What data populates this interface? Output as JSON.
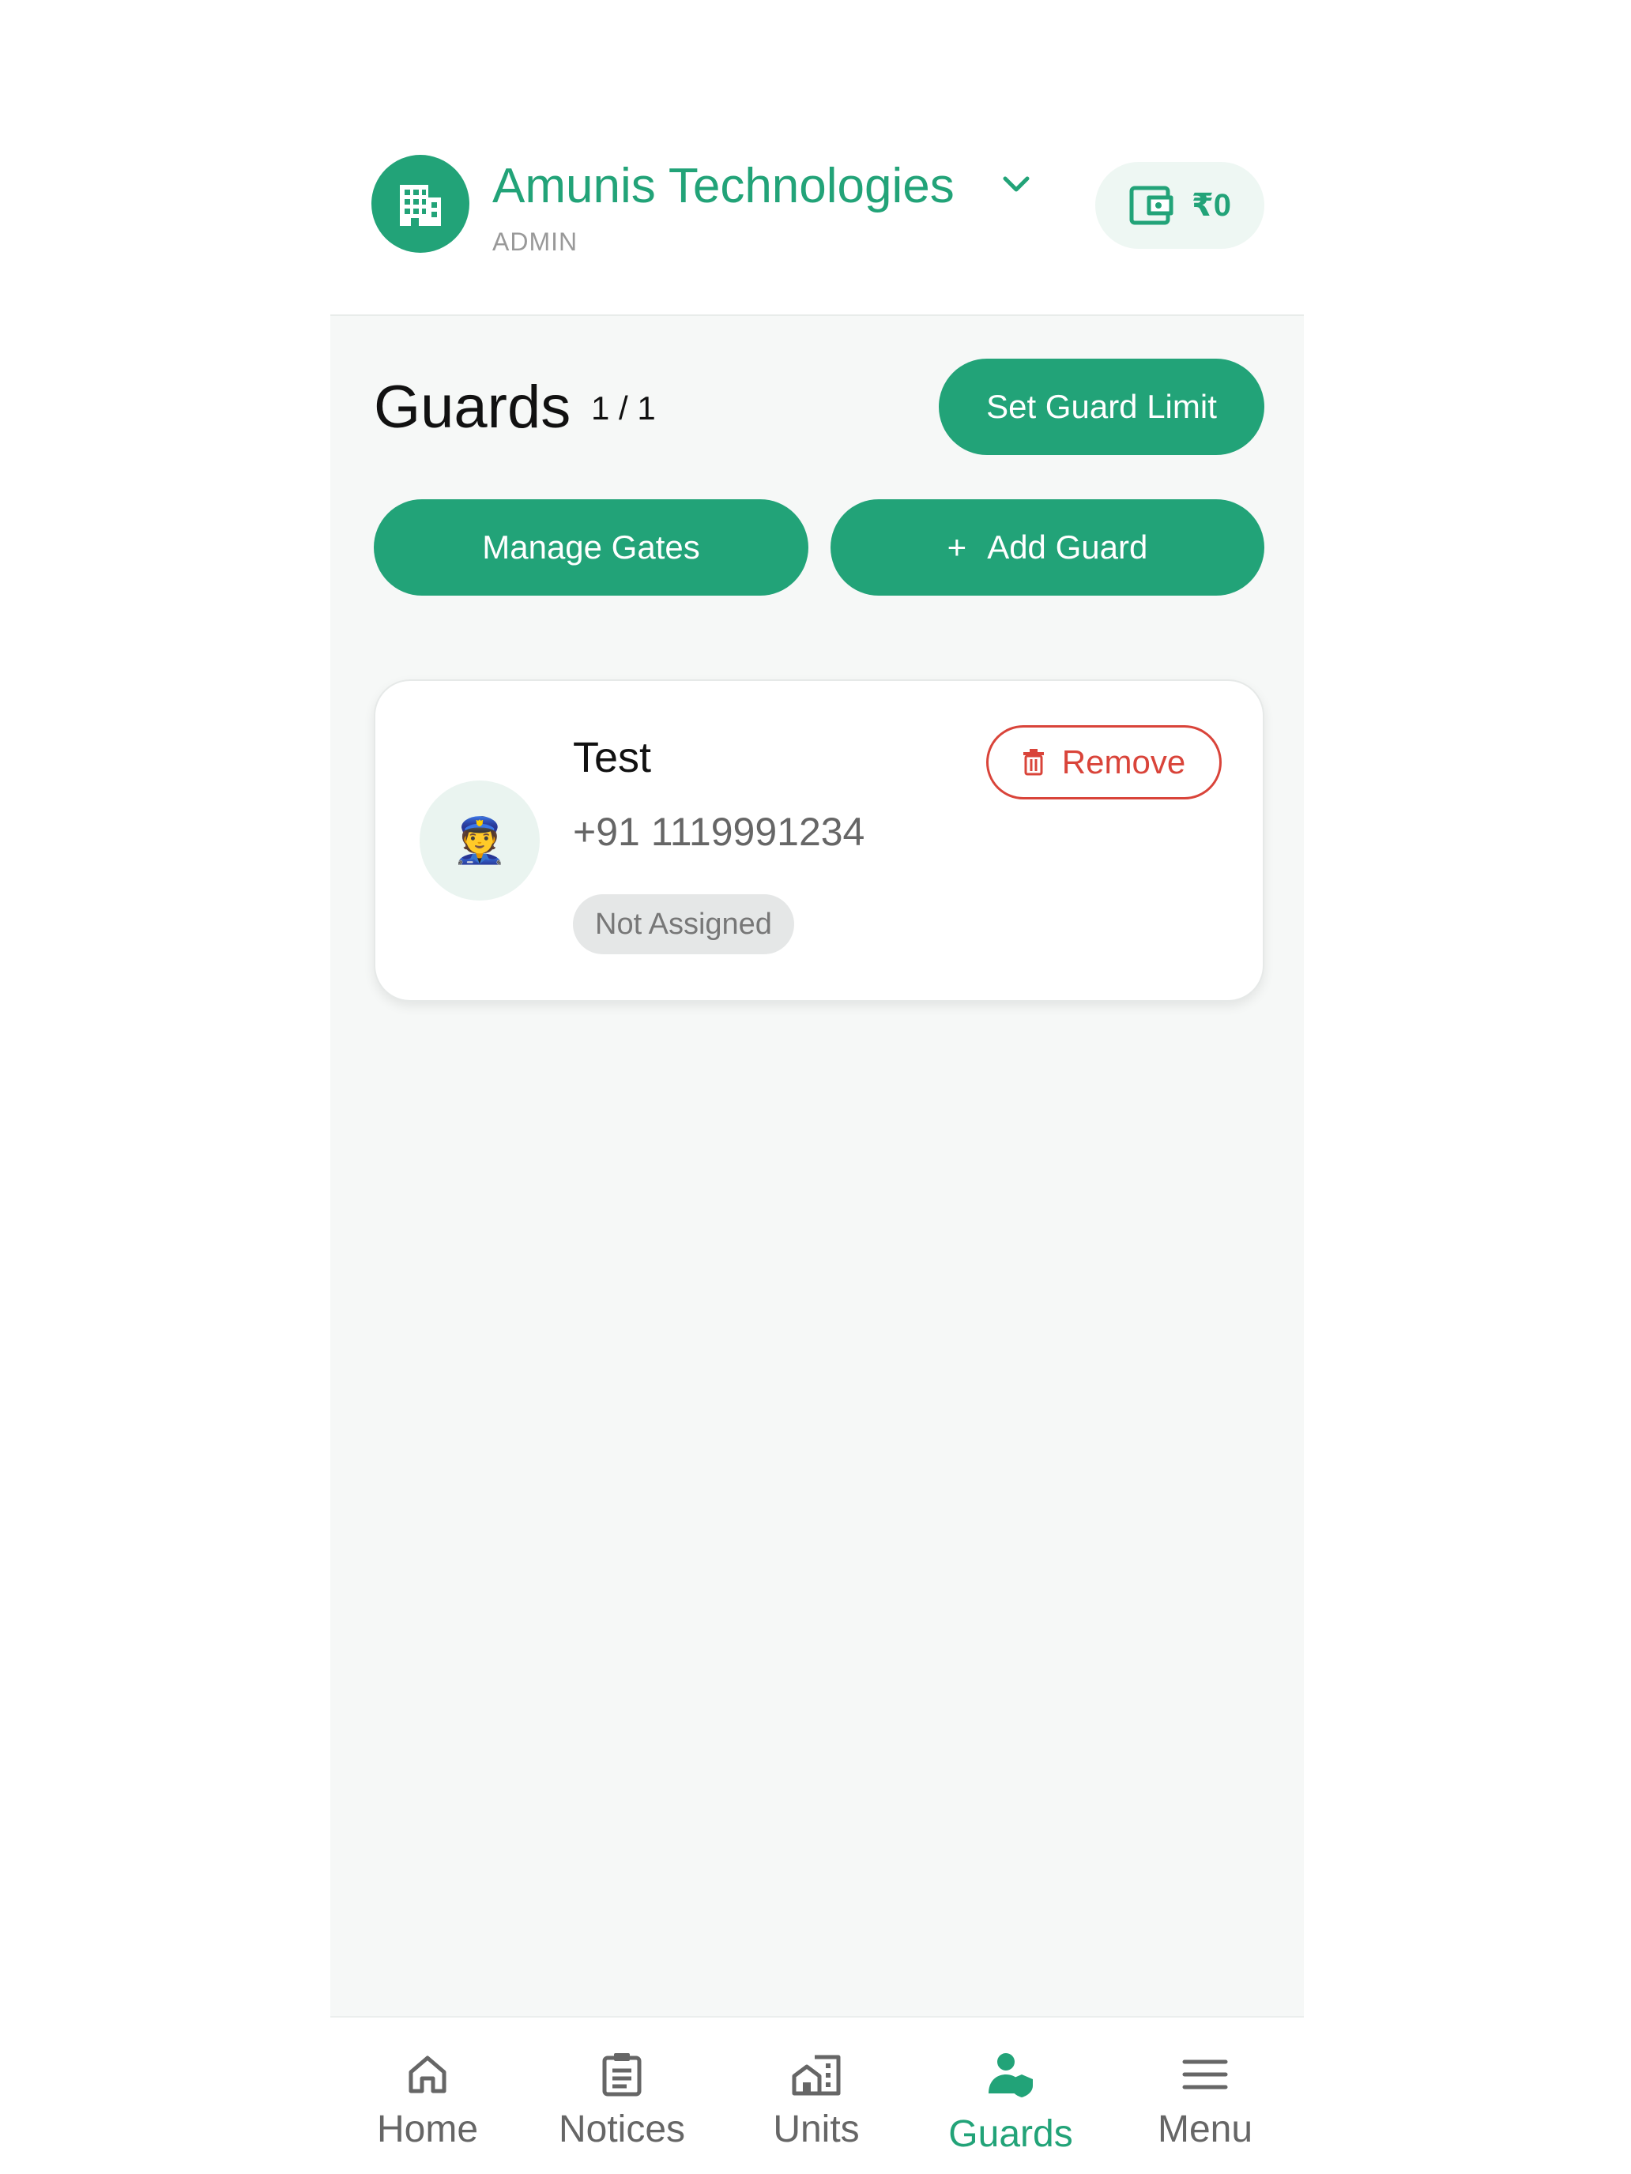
{
  "header": {
    "org_name": "Amunis Technologies",
    "org_role": "ADMIN",
    "wallet_amount": "₹0",
    "org_icon": "building-icon",
    "dropdown_icon": "chevron-down-icon",
    "wallet_icon": "wallet-icon"
  },
  "main": {
    "title": "Guards",
    "count": "1 / 1",
    "set_limit_label": "Set Guard Limit",
    "manage_gates_label": "Manage Gates",
    "add_guard_plus": "+",
    "add_guard_label": "Add Guard"
  },
  "guards": [
    {
      "name": "Test",
      "phone": "+91 1119991234",
      "status": "Not Assigned",
      "avatar_emoji": "👮",
      "remove_label": "Remove"
    }
  ],
  "nav": {
    "items": [
      {
        "label": "Home",
        "icon": "home-icon"
      },
      {
        "label": "Notices",
        "icon": "clipboard-icon"
      },
      {
        "label": "Units",
        "icon": "building-units-icon"
      },
      {
        "label": "Guards",
        "icon": "guard-icon",
        "active": true
      },
      {
        "label": "Menu",
        "icon": "menu-icon"
      }
    ]
  },
  "colors": {
    "accent": "#22a378",
    "danger": "#d9443a",
    "background": "#f6f8f7"
  }
}
